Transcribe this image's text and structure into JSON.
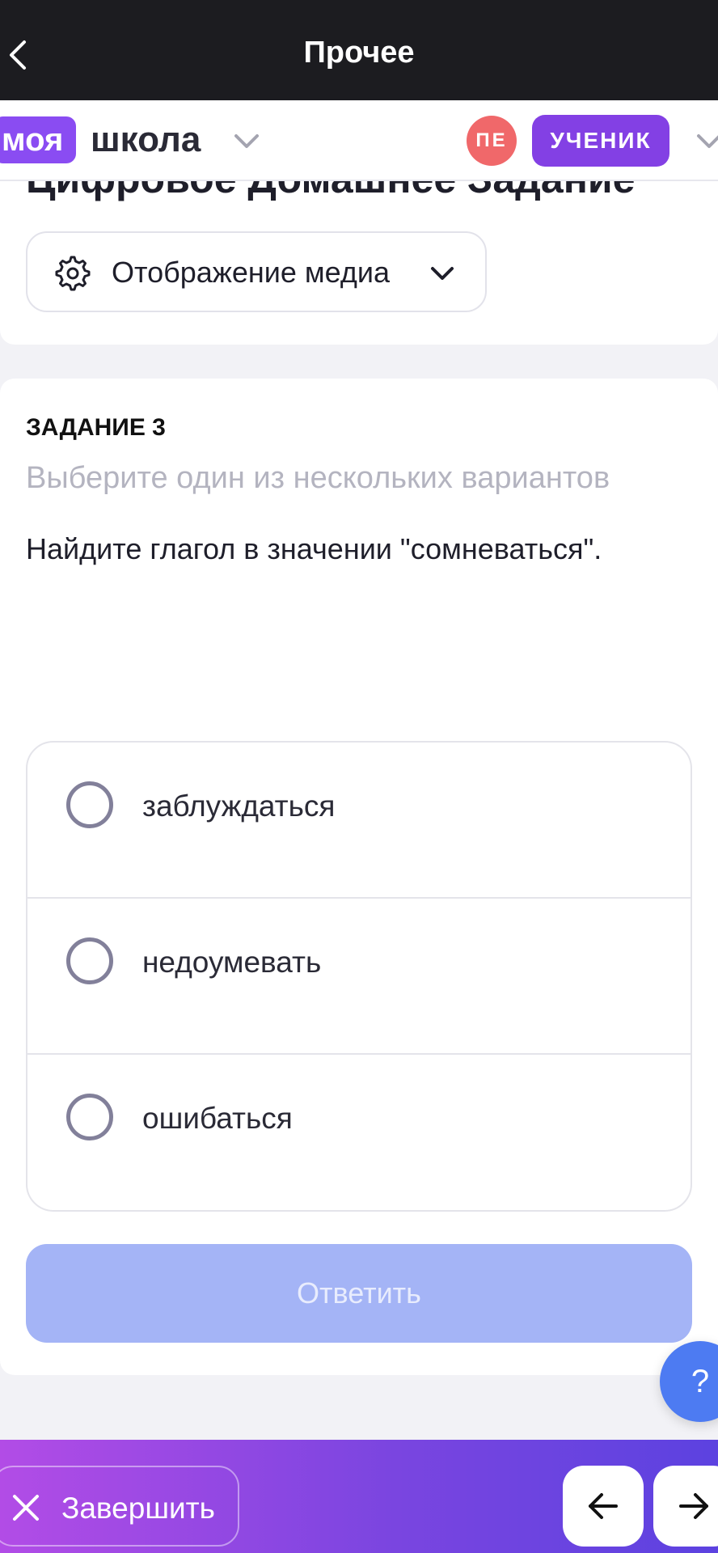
{
  "topbar": {
    "title": "Прочее"
  },
  "header": {
    "logo_pill": "моя",
    "logo_text": "школа",
    "avatar_initials": "ПЕ",
    "role": "УЧЕНИК"
  },
  "section": {
    "title": "Цифровое Домашнее Задание",
    "media_button": "Отображение медиа"
  },
  "task": {
    "label": "ЗАДАНИЕ 3",
    "hint": "Выберите один из нескольких вариантов",
    "question": "Найдите глагол в значении \"сомневаться\".",
    "options": [
      {
        "label": "заблуждаться",
        "selected": false
      },
      {
        "label": "недоумевать",
        "selected": false
      },
      {
        "label": "ошибаться",
        "selected": false
      }
    ],
    "submit_label": "Ответить"
  },
  "help": {
    "label": "?"
  },
  "bottombar": {
    "finish_label": "Завершить"
  },
  "colors": {
    "accent": "#8a4cf2",
    "submit_disabled": "#a4b4f6",
    "help": "#4d7bf2",
    "avatar": "#f0686a"
  }
}
